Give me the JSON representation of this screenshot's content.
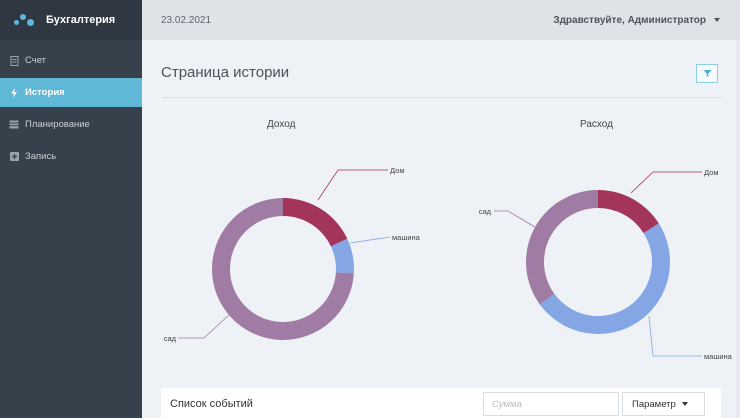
{
  "brand": {
    "name": "Бухгалтерия"
  },
  "sidebar": {
    "items": [
      {
        "label": "Счет",
        "icon": "file-icon"
      },
      {
        "label": "История",
        "icon": "bolt-icon",
        "active": true
      },
      {
        "label": "Планирование",
        "icon": "table-icon"
      },
      {
        "label": "Запись",
        "icon": "plus-square-icon"
      }
    ]
  },
  "header": {
    "date": "23.02.2021",
    "greeting": "Здравствуйте, Администратор"
  },
  "page": {
    "title": "Страница истории"
  },
  "charts": [
    {
      "title": "Доход",
      "slices": [
        {
          "label": "Дом",
          "value": 18,
          "color": "#a3345a"
        },
        {
          "label": "машина",
          "value": 8,
          "color": "#85a6e4"
        },
        {
          "label": "сад",
          "value": 74,
          "color": "#a07ca4"
        }
      ]
    },
    {
      "title": "Расход",
      "slices": [
        {
          "label": "Дом",
          "value": 16,
          "color": "#a3345a"
        },
        {
          "label": "машина",
          "value": 49,
          "color": "#85a6e4"
        },
        {
          "label": "сад",
          "value": 35,
          "color": "#a07ca4"
        }
      ]
    }
  ],
  "events": {
    "title": "Список событий",
    "sum_placeholder": "Сумма",
    "param_label": "Параметр"
  }
}
